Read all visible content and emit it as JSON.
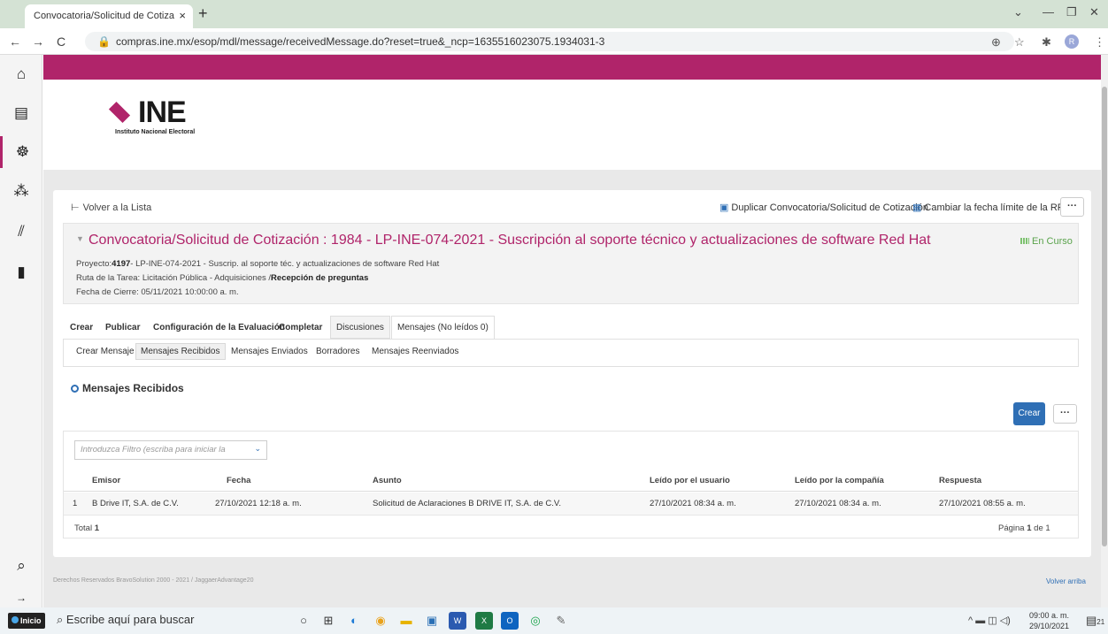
{
  "browser": {
    "tab_title": "Convocatoria/Solicitud de Cotiza",
    "url": "compras.ine.mx/esop/mdl/message/receivedMessage.do?reset=true&_ncp=1635516023075.1934031-3",
    "profile_initial": "R"
  },
  "brand": {
    "accent": "#b0246a",
    "link_blue": "#2f6fb5",
    "logo_word": "INE",
    "logo_subtitle": "Instituto Nacional Electoral"
  },
  "toolbar": {
    "back_label": "Volver a la Lista",
    "duplicate_label": "Duplicar Convocatoria/Solicitud de Cotización",
    "change_date_label": "Cambiar la fecha límite de la RFx",
    "more_label": "···"
  },
  "rfx": {
    "title": "Convocatoria/Solicitud de Cotización : 1984 - LP-INE-074-2021 - Suscripción al soporte técnico y actualizaciones de software Red Hat",
    "status": "En Curso",
    "project_prefix": "Proyecto:",
    "project_code": "4197",
    "project_rest": "- LP-INE-074-2021 - Suscrip. al soporte téc. y actualizaciones de software Red Hat",
    "route_prefix": "Ruta de la Tarea: Licitación Pública - Adquisiciones /",
    "route_bold": "Recepción de preguntas",
    "close_date": "Fecha de Cierre: 05/11/2021 10:00:00 a. m."
  },
  "main_tabs": [
    "Crear",
    "Publicar",
    "Configuración de la Evaluación",
    "Completar",
    "Discusiones",
    "Mensajes (No leídos 0)"
  ],
  "sub_tabs": [
    "Crear Mensaje",
    "Mensajes Recibidos",
    "Mensajes Enviados",
    "Borradores",
    "Mensajes Reenviados"
  ],
  "section_title": "Mensajes Recibidos",
  "create_button": "Crear",
  "filter_placeholder": "Introduzca Filtro (escriba para iniciar la",
  "table": {
    "headers": [
      "Emisor",
      "Fecha",
      "Asunto",
      "Leído por el usuario",
      "Leído por la compañía",
      "Respuesta"
    ],
    "rows": [
      {
        "num": "1",
        "emisor": "B Drive IT, S.A. de C.V.",
        "fecha": "27/10/2021 12:18 a. m.",
        "asunto": "Solicitud de Aclaraciones B DRIVE IT, S.A. de C.V.",
        "leido_usuario": "27/10/2021 08:34 a. m.",
        "leido_compania": "27/10/2021 08:34 a. m.",
        "respuesta": "27/10/2021 08:55 a. m."
      }
    ],
    "total_label": "Total",
    "total_value": "1",
    "page_prefix": "Página",
    "page_current": "1",
    "page_suffix": "de 1"
  },
  "footer": {
    "rights": "Derechos Reservados BravoSolution 2000 - 2021 / JaggaerAdvantage20",
    "back_to_top": "Volver arriba"
  },
  "taskbar": {
    "start_label": "Inicio",
    "search_placeholder": "Escribe aquí para buscar",
    "time": "09:00 a. m.",
    "date": "29/10/2021",
    "notification_count": "21"
  }
}
